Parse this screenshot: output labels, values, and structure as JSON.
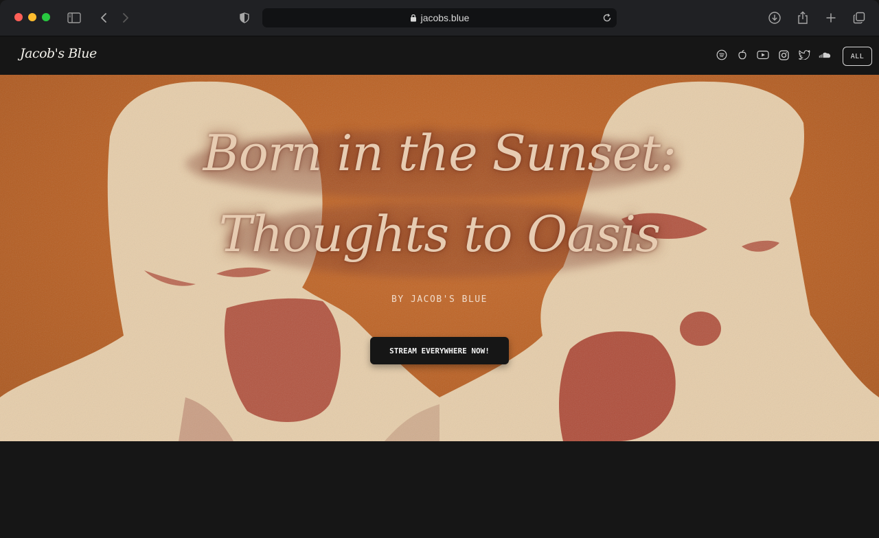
{
  "browser": {
    "url": "jacobs.blue",
    "icons": [
      "sidebar-icon",
      "back-icon",
      "forward-icon",
      "shield-icon",
      "lock-icon",
      "reload-icon",
      "download-icon",
      "share-icon",
      "new-tab-icon",
      "tabs-icon"
    ]
  },
  "header": {
    "logo": "Jacob's Blue",
    "socials": [
      "spotify-icon",
      "apple-icon",
      "youtube-icon",
      "instagram-icon",
      "twitter-icon",
      "soundcloud-icon"
    ],
    "all_label": "ALL"
  },
  "hero": {
    "title_line1": "Born in  the Sunset:",
    "title_line2": "Thoughts to Oasis",
    "byline": "BY JACOB'S BLUE",
    "cta_label": "STREAM EVERYWHERE NOW!",
    "colors": {
      "background": "#b85f22",
      "figure": "#e6cdaa",
      "accent": "#a8402f"
    }
  }
}
